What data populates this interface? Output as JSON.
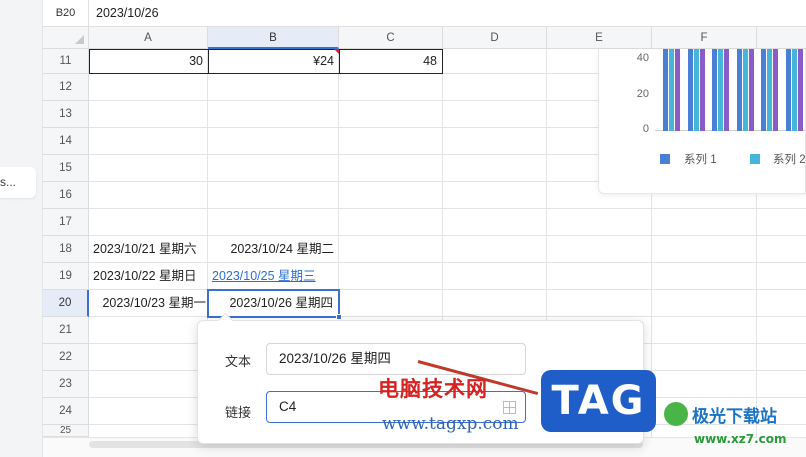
{
  "formula_bar": {
    "cell_ref": "B20",
    "value": "2023/10/26"
  },
  "left_panel": {
    "item_label": "s..."
  },
  "columns": [
    "A",
    "B",
    "C",
    "D",
    "E",
    "F"
  ],
  "rows": [
    "11",
    "12",
    "13",
    "14",
    "15",
    "16",
    "17",
    "18",
    "19",
    "20",
    "21",
    "22",
    "23",
    "24",
    "25"
  ],
  "cells": {
    "A11": "30",
    "B11": "¥24",
    "C11": "48",
    "A18": "2023/10/21 星期六",
    "B18": "2023/10/24 星期二",
    "A19": "2023/10/22 星期日",
    "B19": "2023/10/25 星期三",
    "A20": "2023/10/23 星期一",
    "B20": "2023/10/26 星期四"
  },
  "chart": {
    "y_ticks": [
      "40",
      "20",
      "0"
    ],
    "legend": [
      "系列 1",
      "系列 2"
    ],
    "colors": {
      "series1": "#4a7fd6",
      "series2": "#45b6d8",
      "accent": "#8a5cc7"
    }
  },
  "chart_data": {
    "type": "bar",
    "y_ticks": [
      0,
      20,
      40
    ],
    "series": [
      {
        "name": "系列 1",
        "values": []
      },
      {
        "name": "系列 2",
        "values": []
      }
    ],
    "legend_position": "bottom"
  },
  "dialog": {
    "text_label": "文本",
    "text_value": "2023/10/26 星期四",
    "link_label": "链接",
    "link_value": "C4"
  },
  "watermark": {
    "site_name_cn": "电脑技术网",
    "site_url": "www.tagxp.com",
    "tag_logo": "TAG",
    "xz_name": "极光下载站",
    "xz_url": "www.xz7.com"
  }
}
